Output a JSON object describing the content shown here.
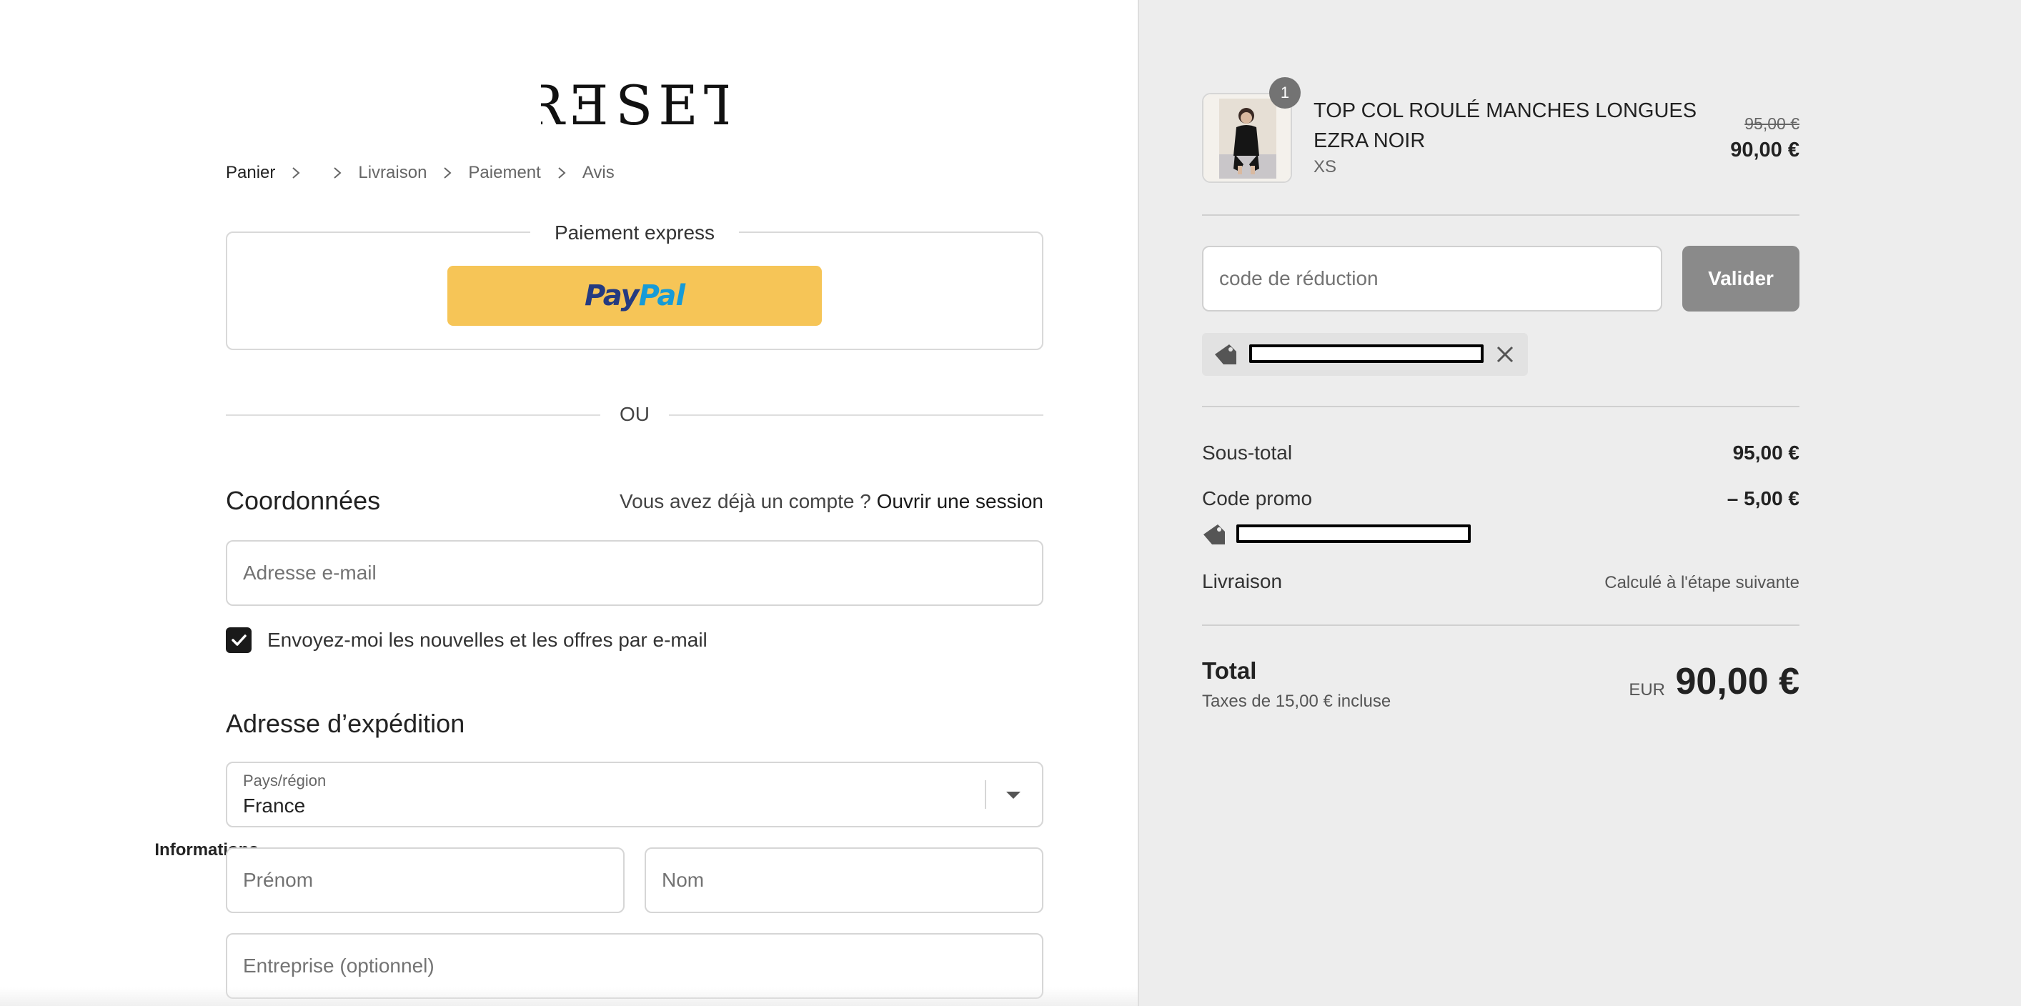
{
  "brand": {
    "logo_text": "RƎSET"
  },
  "breadcrumb": [
    {
      "label": "Panier"
    },
    {
      "label": "Informations"
    },
    {
      "label": "Livraison"
    },
    {
      "label": "Paiement"
    },
    {
      "label": "Avis"
    }
  ],
  "express": {
    "title": "Paiement express",
    "paypal_part1": "Pay",
    "paypal_part2": "Pal"
  },
  "divider": {
    "label": "OU"
  },
  "contact": {
    "heading": "Coordonnées",
    "account_prompt": "Vous avez déjà un compte ?",
    "login_link": "Ouvrir une session",
    "email_placeholder": "Adresse e-mail",
    "newsletter_label": "Envoyez-moi les nouvelles et les offres par e-mail",
    "newsletter_checked": true
  },
  "shipping": {
    "heading": "Adresse d’expédition",
    "country_label": "Pays/région",
    "country_value": "France",
    "first_name_placeholder": "Prénom",
    "last_name_placeholder": "Nom",
    "company_placeholder": "Entreprise (optionnel)"
  },
  "cart": {
    "item": {
      "quantity": "1",
      "name": "TOP COL ROULÉ MANCHES LONGUES EZRA NOIR",
      "variant": "XS",
      "original_price": "95,00 €",
      "price": "90,00 €"
    },
    "discount": {
      "placeholder": "code de réduction",
      "button": "Valider"
    },
    "summary": {
      "subtotal_label": "Sous-total",
      "subtotal_value": "95,00 €",
      "promo_label": "Code promo",
      "promo_value": "– 5,00 €",
      "shipping_label": "Livraison",
      "shipping_value": "Calculé à l'étape suivante",
      "total_label": "Total",
      "tax_note": "Taxes de 15,00 € incluse",
      "currency": "EUR",
      "total_value": "90,00 €"
    }
  }
}
